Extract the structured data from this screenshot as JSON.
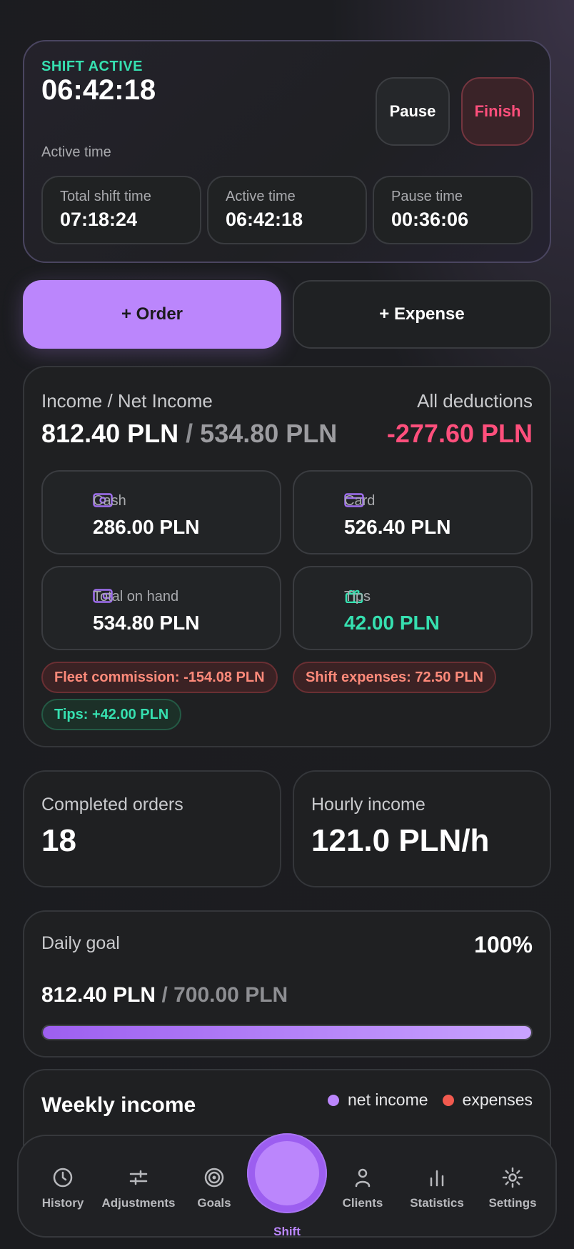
{
  "shift": {
    "status": "SHIFT ACTIVE",
    "clock": "06:42:18",
    "subtitle": "Active time",
    "pause_label": "Pause",
    "finish_label": "Finish",
    "times": [
      {
        "label": "Total shift time",
        "value": "07:18:24"
      },
      {
        "label": "Active time",
        "value": "06:42:18"
      },
      {
        "label": "Pause time",
        "value": "00:36:06"
      }
    ]
  },
  "actions": {
    "order_label": "+ Order",
    "expense_label": "+ Expense"
  },
  "income": {
    "title": "Income / Net Income",
    "gross": "812.40 PLN",
    "separator": "/",
    "net": "534.80 PLN",
    "deductions_title": "All deductions",
    "deductions_value": "-277.60 PLN",
    "tiles": [
      {
        "label": "Cash",
        "value": "286.00 PLN",
        "icon": "cash-icon"
      },
      {
        "label": "Card",
        "value": "526.40 PLN",
        "icon": "card-icon"
      },
      {
        "label": "Total on hand",
        "value": "534.80 PLN",
        "icon": "wallet-icon"
      },
      {
        "label": "Tips",
        "value": "42.00 PLN",
        "icon": "gift-icon"
      }
    ],
    "chips": [
      "Fleet commission: -154.08 PLN",
      "Shift expenses: 72.50 PLN",
      "Tips: +42.00 PLN"
    ]
  },
  "stats": {
    "orders_label": "Completed orders",
    "orders_value": "18",
    "hourly_label": "Hourly income",
    "hourly_value": "121.0 PLN/h"
  },
  "goal": {
    "label": "Daily goal",
    "percent": "100%",
    "current": "812.40 PLN",
    "target": "/ 700.00 PLN",
    "progress": 1.0
  },
  "weekly": {
    "title": "Weekly income",
    "legend": [
      {
        "label": "net income",
        "color": "#bb86fc"
      },
      {
        "label": "expenses",
        "color": "#f25a4f"
      }
    ]
  },
  "nav": {
    "items": [
      {
        "label": "History",
        "icon": "clock-icon"
      },
      {
        "label": "Adjustments",
        "icon": "sliders-icon"
      },
      {
        "label": "Goals",
        "icon": "target-icon"
      },
      {
        "label": "Clients",
        "icon": "person-icon"
      },
      {
        "label": "Statistics",
        "icon": "bar-chart-icon"
      },
      {
        "label": "Settings",
        "icon": "gear-icon"
      }
    ],
    "center_label": "Shift"
  },
  "colors": {
    "accent": "#bb86fc",
    "success": "#36e0b0",
    "danger": "#ff4f7c"
  }
}
